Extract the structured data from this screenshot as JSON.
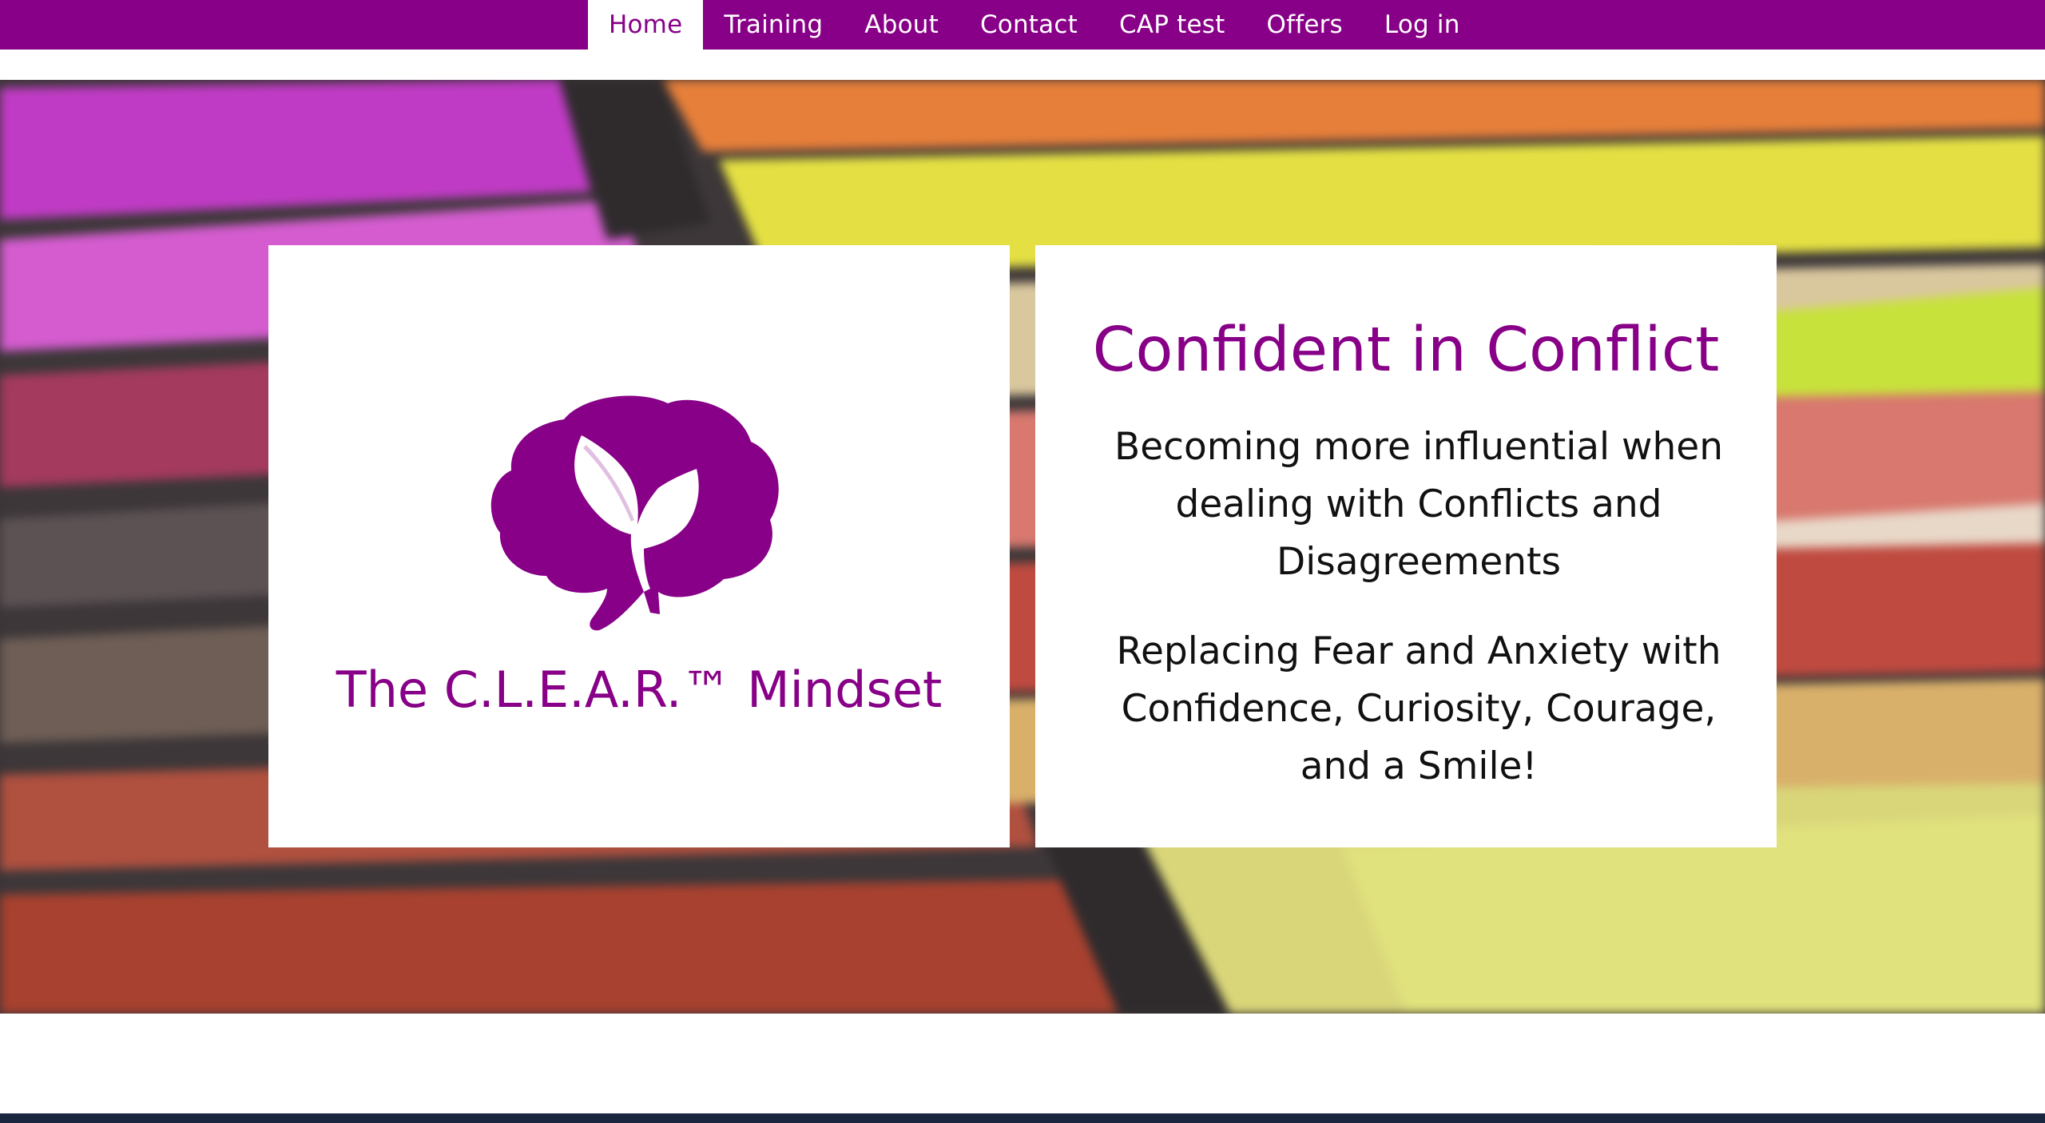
{
  "nav": {
    "items": [
      {
        "label": "Home",
        "active": true
      },
      {
        "label": "Training"
      },
      {
        "label": "About"
      },
      {
        "label": "Contact"
      },
      {
        "label": "CAP test"
      },
      {
        "label": "Offers"
      },
      {
        "label": "Log in"
      }
    ]
  },
  "hero": {
    "left_panel": {
      "logo_icon": "brain-with-sprout-icon",
      "title": "The C.L.E.A.R.™ Mindset"
    },
    "right_panel": {
      "title": "Confident in Conflict",
      "tagline_1": "Becoming more influential when dealing with Conflicts and Disagreements",
      "tagline_2": "Replacing Fear and Anxiety with Confidence, Curiosity, Courage, and a Smile!"
    }
  },
  "colors": {
    "brand_purple": "#870087",
    "nav_text": "#ffffff",
    "body_text": "#111111"
  }
}
